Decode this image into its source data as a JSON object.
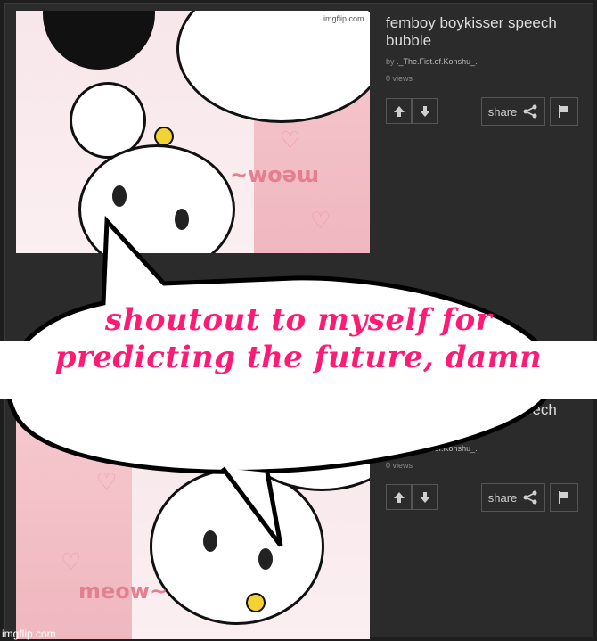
{
  "posts": [
    {
      "title": "femboy boykisser speech bubble",
      "by_prefix": "by",
      "username": "._The.Fist.of.Konshu_.",
      "views": "0 views",
      "share_label": "share"
    },
    {
      "title": "femboy boykisser speech bubble",
      "by_prefix": "by",
      "username": "._The.Fist.of.Konshu_.",
      "views": "0 views",
      "share_label": "share"
    }
  ],
  "caption": {
    "line1": "shoutout to myself for",
    "line2": "predicting the future, damn"
  },
  "image_text": {
    "meow_top": "~woəɯ",
    "meow_bottom": "meow~",
    "watermark_top": "imgflip.com"
  },
  "watermark": "imgflip.com",
  "colors": {
    "caption": "#ff1a75",
    "panel_bg": "#2b2b2b"
  }
}
